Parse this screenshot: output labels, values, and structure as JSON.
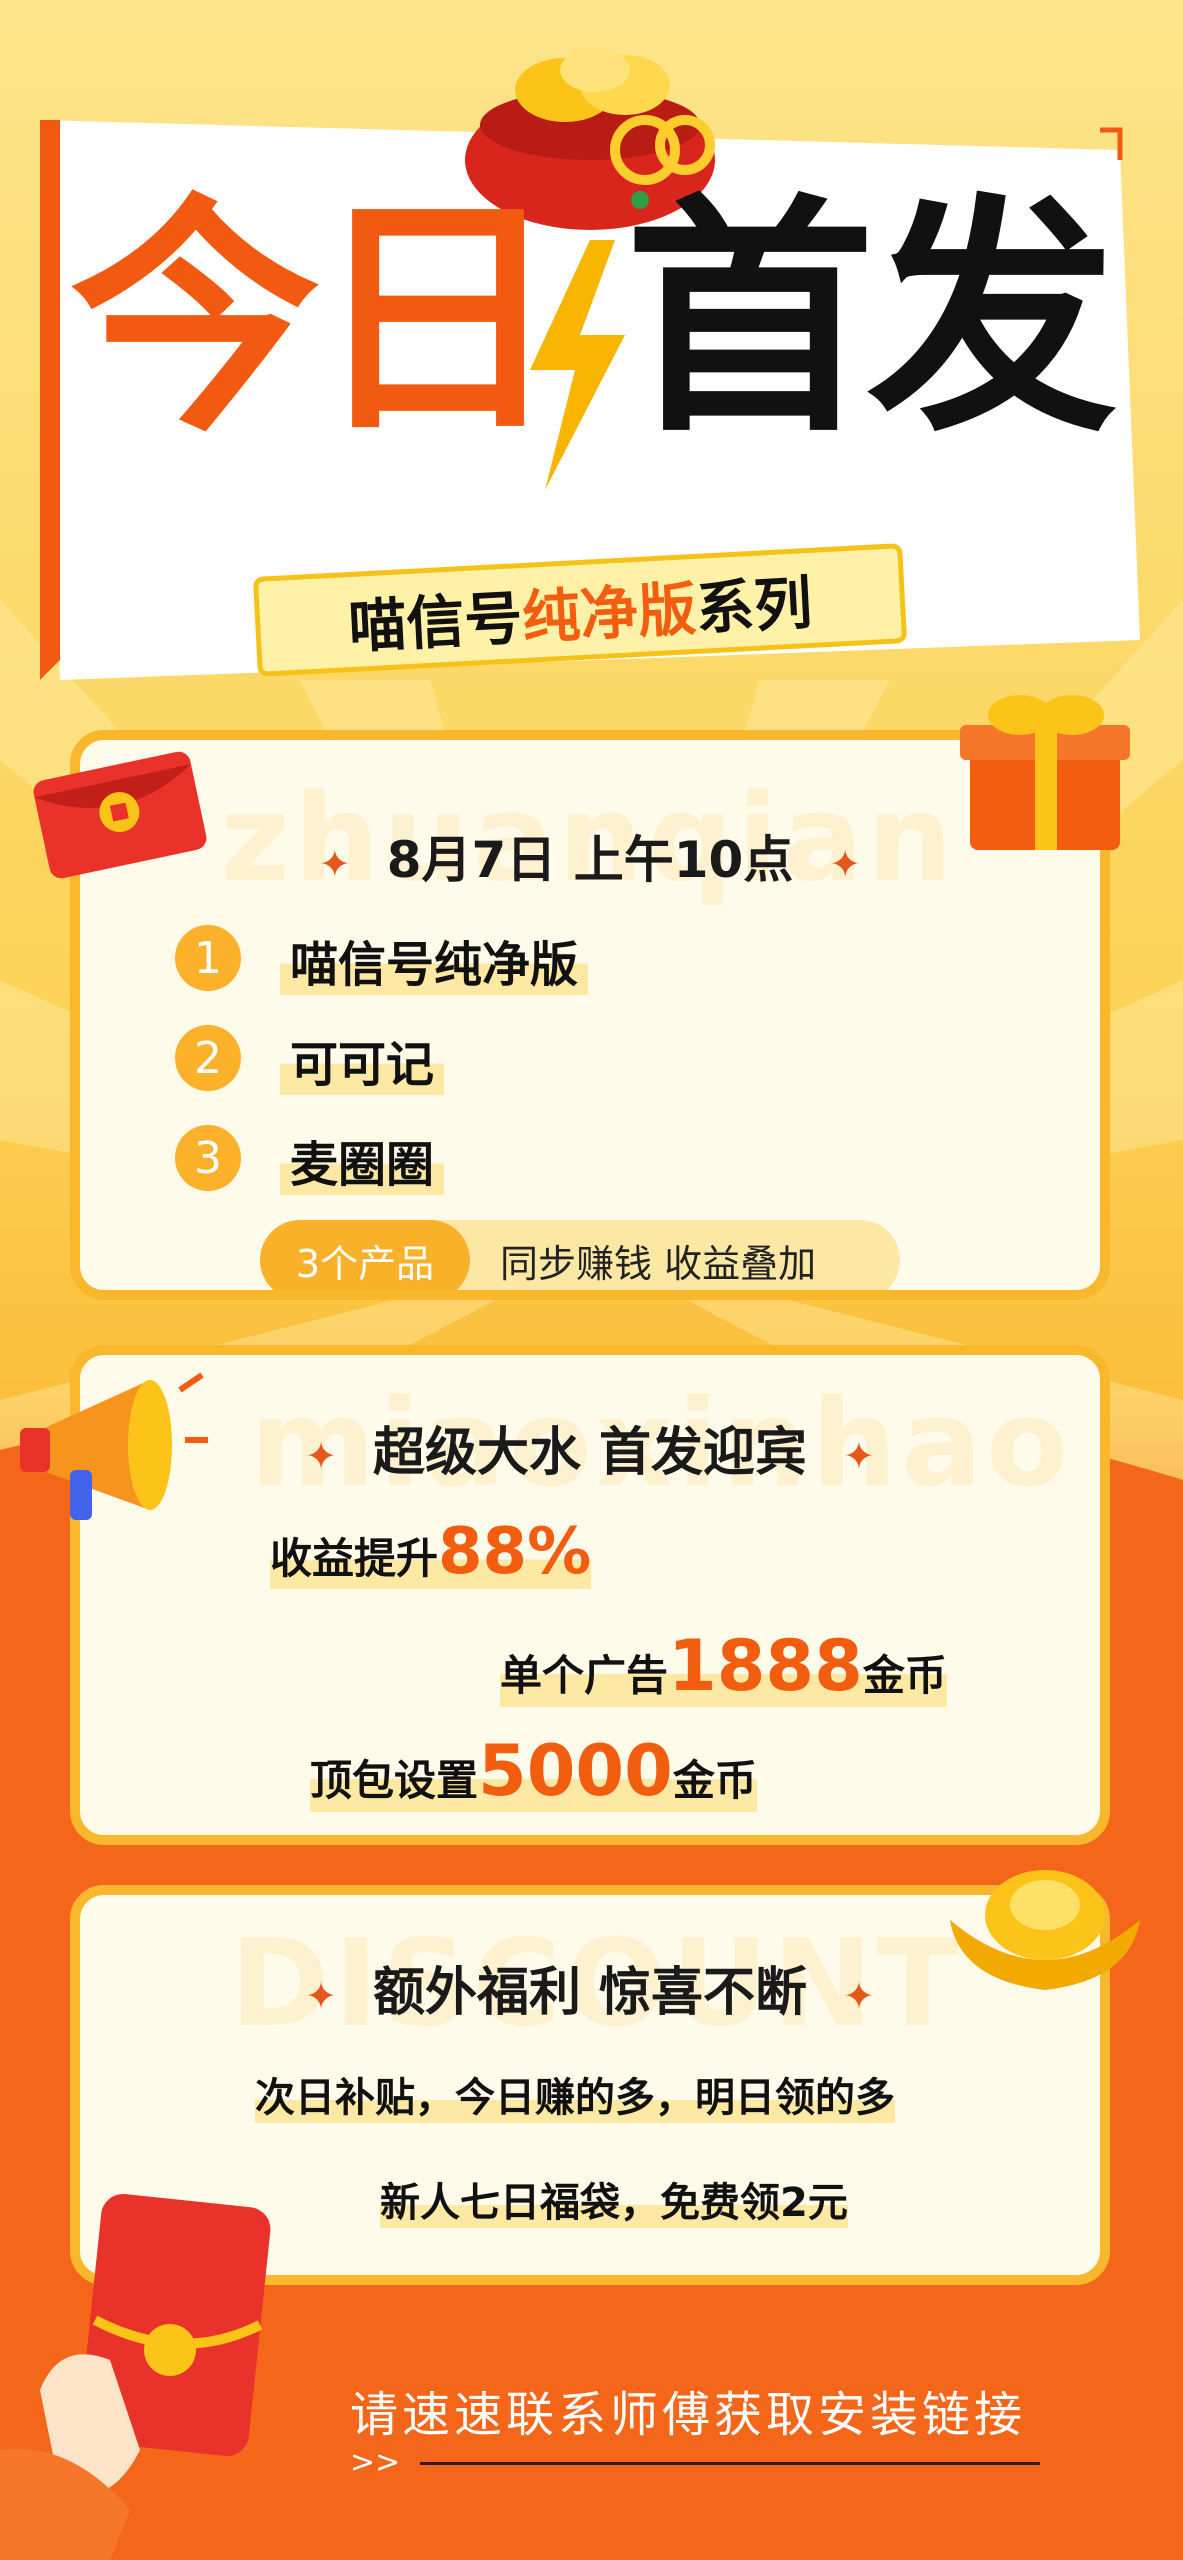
{
  "header": {
    "headline_part1": "今日",
    "headline_part2": "首发",
    "subtitle_a": "喵信号",
    "subtitle_b": "纯净版",
    "subtitle_c": "系列"
  },
  "card1": {
    "watermark": "zhuanqian",
    "title": "8月7日 上午10点",
    "items": [
      {
        "num": "1",
        "label": "喵信号纯净版"
      },
      {
        "num": "2",
        "label": "可可记"
      },
      {
        "num": "3",
        "label": "麦圈圈"
      }
    ],
    "pill_tag": "3个产品",
    "pill_text": "同步赚钱  收益叠加"
  },
  "card2": {
    "watermark": "miaoxinhao",
    "title": "超级大水 首发迎宾",
    "line1_prefix": "收益提升",
    "line1_value": "88%",
    "line2_prefix": "单个广告",
    "line2_value": "1888",
    "line2_suffix": "金币",
    "line3_prefix": "顶包设置",
    "line3_value": "5000",
    "line3_suffix": "金币"
  },
  "card3": {
    "watermark": "DISCOUNT",
    "title": "额外福利 惊喜不断",
    "line1": "次日补贴，今日赚的多，明日领的多",
    "line2": "新人七日福袋，免费领2元"
  },
  "footer": {
    "cta": "请速速联系师傅获取安装链接",
    "arrow": ">>"
  },
  "colors": {
    "accent_orange": "#f25d10",
    "card_border": "#f9b72c",
    "card_bg": "#fffbea"
  },
  "icons": [
    "lucky-bag-icon",
    "lightning-icon",
    "red-envelope-icon",
    "gift-box-icon",
    "megaphone-icon",
    "gold-ingot-icon",
    "hand-red-envelope-icon",
    "sparkle-icon"
  ]
}
